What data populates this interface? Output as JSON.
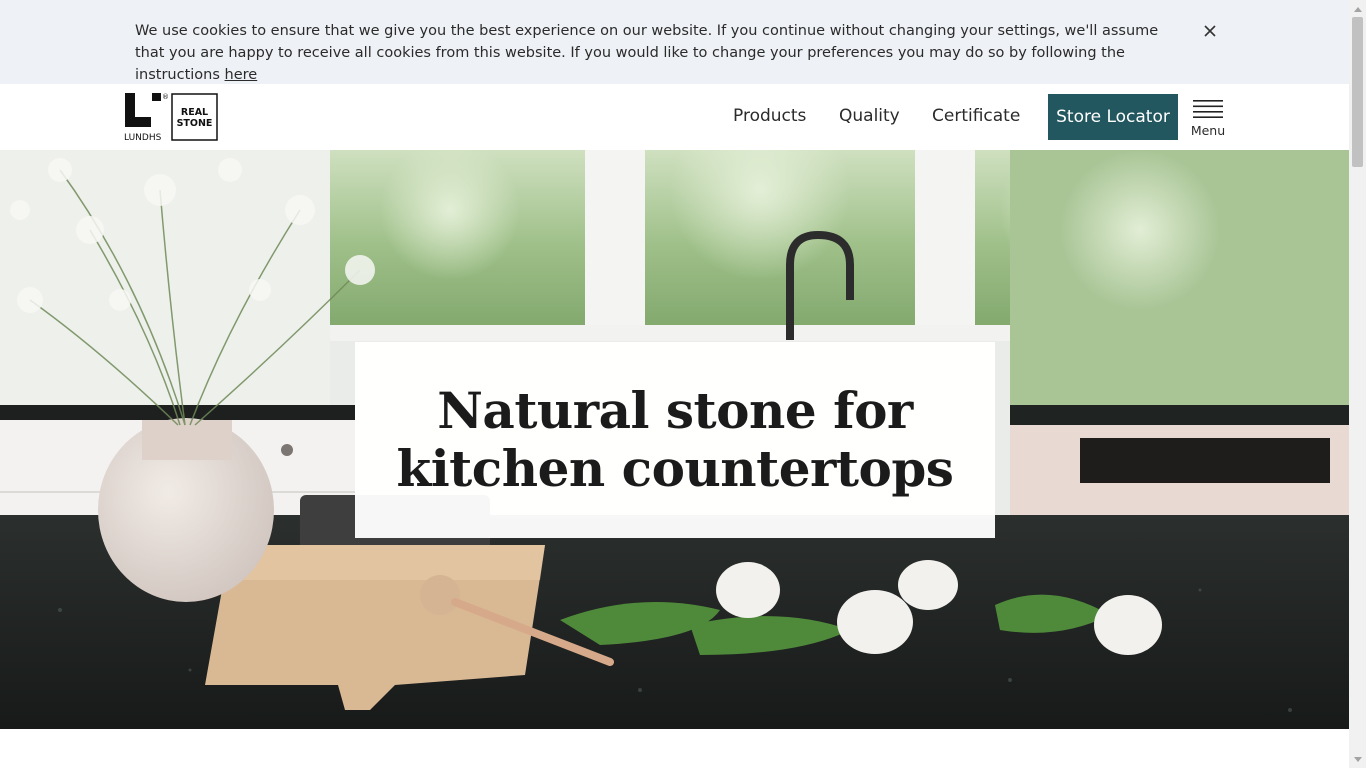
{
  "cookie_banner": {
    "text": "We use cookies to ensure that we give you the best experience on our website. If you continue without changing your settings, we'll assume that you are happy to receive all cookies from this website. If you would like to change your preferences you may do so by following the instructions ",
    "link_label": "here",
    "close_icon": "close-icon"
  },
  "logo": {
    "brand": "LUNDHS",
    "badge_line1": "REAL",
    "badge_line2": "STONE",
    "registered": "®"
  },
  "nav": {
    "items": [
      {
        "label": "Products"
      },
      {
        "label": "Quality"
      },
      {
        "label": "Certificate"
      }
    ],
    "store_locator_label": "Store Locator",
    "menu_label": "Menu",
    "menu_icon": "hamburger-icon"
  },
  "hero": {
    "title_line1": "Natural stone for",
    "title_line2": "kitchen countertops"
  },
  "colors": {
    "accent": "#22575f",
    "banner_bg": "#eef1f5"
  }
}
